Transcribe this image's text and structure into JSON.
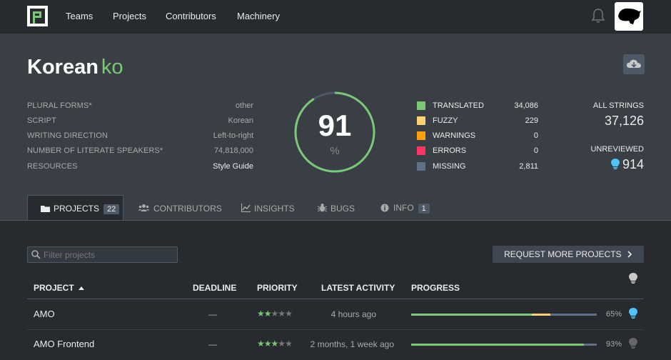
{
  "nav": {
    "links": [
      "Teams",
      "Projects",
      "Contributors",
      "Machinery"
    ]
  },
  "locale": {
    "name": "Korean",
    "code": "ko"
  },
  "meta": [
    {
      "label": "Plural forms*",
      "value": "other"
    },
    {
      "label": "Script",
      "value": "Korean"
    },
    {
      "label": "Writing direction",
      "value": "Left-to-right"
    },
    {
      "label": "Number of literate speakers*",
      "value": "74,818,000"
    },
    {
      "label": "Resources",
      "value": "Style Guide"
    }
  ],
  "progress": {
    "percent": "91",
    "symbol": "%"
  },
  "legend": [
    {
      "label": "Translated",
      "value": "34,086",
      "color": "#7bc876"
    },
    {
      "label": "Fuzzy",
      "value": "229",
      "color": "#fed271"
    },
    {
      "label": "Warnings",
      "value": "0",
      "color": "#ffa10f"
    },
    {
      "label": "Errors",
      "value": "0",
      "color": "#f36"
    },
    {
      "label": "Missing",
      "value": "2,811",
      "color": "#5f7285"
    }
  ],
  "stats": {
    "all_strings_label": "All strings",
    "all_strings_value": "37,126",
    "unreviewed_label": "Unreviewed",
    "unreviewed_value": "914"
  },
  "tabs": [
    {
      "label": "Projects",
      "count": "22",
      "icon": "folder-icon"
    },
    {
      "label": "Contributors",
      "count": "",
      "icon": "users-icon"
    },
    {
      "label": "Insights",
      "count": "",
      "icon": "chart-icon"
    },
    {
      "label": "Bugs",
      "count": "",
      "icon": "bug-icon"
    },
    {
      "label": "Info",
      "count": "1",
      "icon": "info-icon"
    }
  ],
  "search": {
    "placeholder": "Filter projects"
  },
  "request_button": "Request more projects",
  "table": {
    "headers": {
      "project": "Project",
      "deadline": "Deadline",
      "priority": "Priority",
      "latest_activity": "Latest activity",
      "progress": "Progress"
    },
    "rows": [
      {
        "name": "AMO",
        "deadline": "—",
        "priority": 2,
        "activity": "4 hours ago",
        "progress": "65%",
        "translated": 0.65,
        "fuzzy": 0.1,
        "unreviewed": true
      },
      {
        "name": "AMO Frontend",
        "deadline": "—",
        "priority": 3,
        "activity": "2 months, 1 week ago",
        "progress": "93%",
        "translated": 0.93,
        "fuzzy": 0.0,
        "unreviewed": false
      }
    ]
  },
  "colors": {
    "accent": "#7bc876",
    "bulb_active": "#4fc4f6",
    "bulb_inactive": "#666666"
  }
}
